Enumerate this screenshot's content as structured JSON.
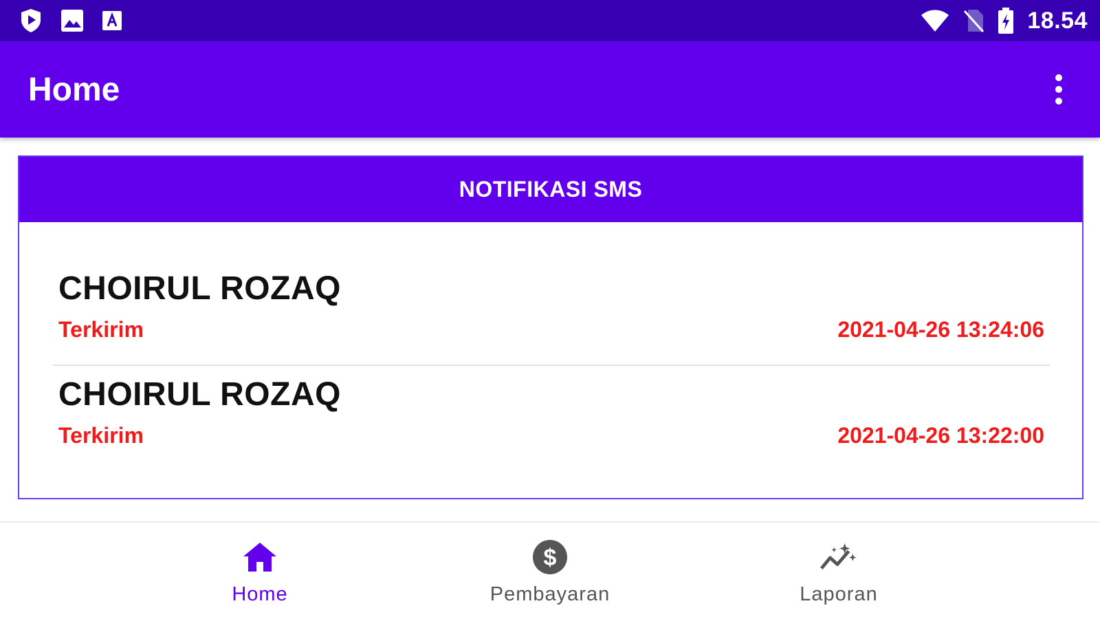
{
  "status_bar": {
    "time": "18.54",
    "left_icons": [
      "play-protect-icon",
      "image-icon",
      "font-a-icon"
    ],
    "right_icons": [
      "wifi-icon",
      "no-sim-icon",
      "battery-charging-icon"
    ]
  },
  "app_bar": {
    "title": "Home",
    "overflow_icon": "more-vert-icon"
  },
  "card": {
    "title": "NOTIFIKASI SMS",
    "items": [
      {
        "name": "CHOIRUL ROZAQ",
        "status": "Terkirim",
        "datetime": "2021-04-26 13:24:06"
      },
      {
        "name": "CHOIRUL ROZAQ",
        "status": "Terkirim",
        "datetime": "2021-04-26 13:22:00"
      }
    ]
  },
  "bottom_nav": {
    "active_index": 0,
    "items": [
      {
        "label": "Home",
        "icon": "home-icon"
      },
      {
        "label": "Pembayaran",
        "icon": "dollar-circle-icon"
      },
      {
        "label": "Laporan",
        "icon": "sparkle-chart-icon"
      }
    ]
  },
  "colors": {
    "status_bar": "#3700b3",
    "primary": "#6200ee",
    "accent_text": "#ee1c1c",
    "inactive_icon": "#555555"
  }
}
